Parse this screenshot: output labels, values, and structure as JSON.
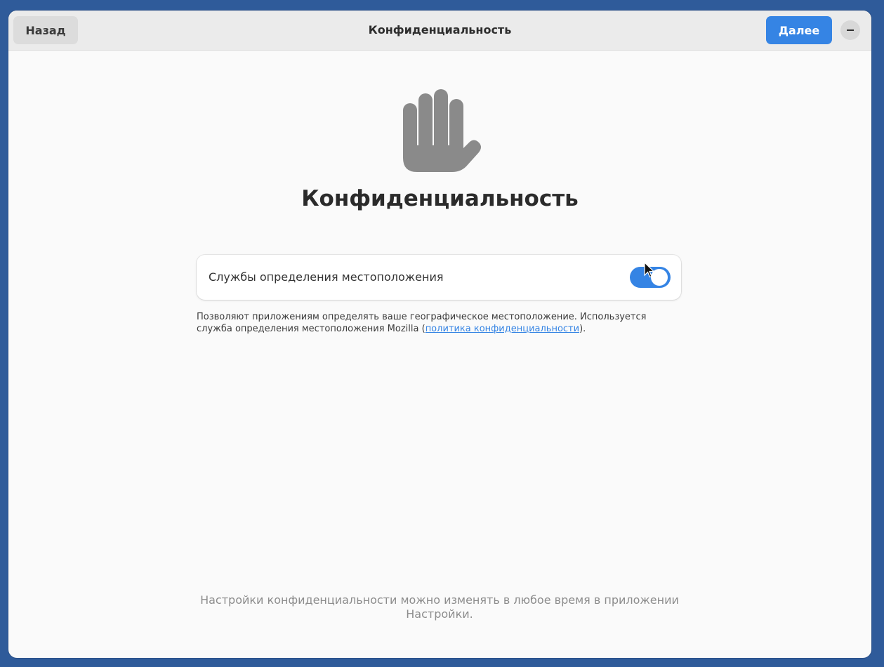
{
  "header": {
    "back_label": "Назад",
    "title": "Конфиденциальность",
    "next_label": "Далее"
  },
  "main": {
    "icon": "hand-icon",
    "heading": "Конфиденциальность",
    "location_services": {
      "label": "Службы определения местоположения",
      "enabled": true
    },
    "description_prefix": "Позволяют приложениям определять ваше географическое местоположение. Используется служба определения местоположения Mozilla (",
    "description_link": "политика конфиденциальности",
    "description_suffix": ")."
  },
  "footer": {
    "note": "Настройки конфиденциальности можно изменять в любое время в приложении Настройки."
  },
  "colors": {
    "accent": "#3584e4",
    "icon": "#8a8a8a"
  }
}
